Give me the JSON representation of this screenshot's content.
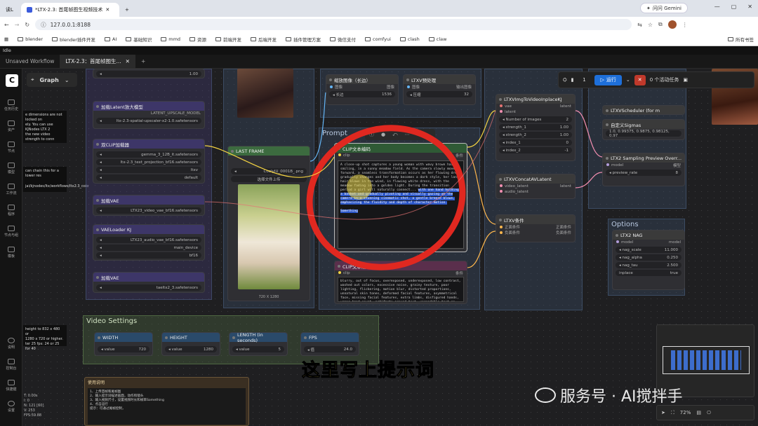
{
  "browser": {
    "tab1_label": "读L",
    "tab2_label": "*LTX-2.3: 首尾帧图生视频技术",
    "url": "127.0.0.1:8188",
    "gemini_label": "问问 Gemini",
    "bookmarks": [
      "blender",
      "blender插件开发",
      "AI",
      "基础知识",
      "mmd",
      "资源",
      "前端开发",
      "后端开发",
      "插件管理方案",
      "微信支付",
      "comfyui",
      "clash",
      "claw"
    ],
    "all_bookmarks": "所有书签"
  },
  "app": {
    "title": "Idle",
    "workflow_tabs": [
      "Unsaved Workflow",
      "LTX-2.3：首尾帧图生..."
    ],
    "view_mode": "Graph",
    "run_label": "运行",
    "queue_count": "1",
    "active_tasks": "0 个活动任务"
  },
  "sidebar": {
    "items": [
      "任务历史",
      "资产",
      "节点",
      "模型",
      "工作流",
      "程序",
      "节点与组",
      "模板",
      "说明",
      "控制台",
      "快捷键",
      "设置"
    ]
  },
  "left_panel": {
    "lines_top": [
      "e dimensions are not locked on",
      "ely. You can use KJNodes LTX 2",
      "the new video strength to conn"
    ],
    "line_mid": "can chain this for a lower res",
    "link": "jai/kjnodes/ltx/workflows/ltx2.3_colo",
    "lines_bottom": [
      "height to 832 x 480 or",
      "1280 x 720 or higher.",
      "ter 25 fps: 24 or 25 for 40"
    ],
    "stats": [
      "T: 0.00s",
      "I: 0",
      "N: 121 [60]",
      "V: 253",
      "FPS:59.88"
    ]
  },
  "nodes": {
    "strength_val": "1.00",
    "latent_upscale_title": "加载Latent放大模型",
    "latent_upscale_model": "LATENT_UPSCALE_MODEL",
    "upscale_model_file": "ltx-2.3-spatial-upscaler-x2-1.0.safetensors",
    "dual_clip_title": "双CLIP加载器",
    "clip_name1": "gemma_3_12B_it.safetensors",
    "clip_name2": "ltx-2.3_text_projection_bf16.safetensors",
    "clip_type": "ltxv",
    "clip_device": "default",
    "vae_loader1": "加载VAE",
    "vae_file1": "LTX23_video_vae_bf16.safetensors",
    "vae_kj_title": "VAELoader KJ",
    "vae_kj_file": "LTX23_audio_vae_bf16.safetensors",
    "vae_kj_device": "main_device",
    "vae_kj_dtype": "bf16",
    "vae_loader2": "加载VAE",
    "vae_file2": "taeltx2_3.safetensors",
    "last_frame_title": "LAST FRAME",
    "image_file": "CoolyIU_0001B_.png",
    "upload_label": "选择文件上传",
    "img_size": "720 X 1280",
    "clip_encode_title": "CLIP文本编码",
    "clip_encode_neg_title": "CLIP文本编码",
    "prompt_group": "Prompt",
    "prompt_text": "A close-up shot captures a young woman with wavy brown hair, smiling, in a sunny meadow field. As the camera slowly moves forward, a seamless transformation occurs as her flowing dress gradually changes and her body becomes a dark style, her long hair blows in the wind, in flowing white dress, with the meadow fading into a golden light. During the transition period a girl will naturally connect...",
    "prompt_highlight": "with one hand holding a basket and gradually pivoting and visually gazing at the camera in a stunning cinematic shot, a gentle breeze blows, emphasizing the fluidity and depth of character motion.",
    "prompt_end": "Something",
    "neg_text": "blurry, out of focus, overexposed, underexposed, low contrast, washed out colors, excessive noise, grainy texture, poor lighting, flickering, motion blur, distorted proportions, unnatural skin tones, deformed facial features, asymmetrical face, missing facial features, extra limbs, disfigured hands, wrong hand count, artifacts around text, unreadable text on shirt or hat, incorrect lettering on cap ('PNTR'), incorrect lettering on shirt ('JOY'), shaking movement...",
    "video_settings": "Video Settings",
    "width_val": "720",
    "height_val": "1280",
    "length_val": "5",
    "fps_val": "24.0",
    "width_label": "WIDTH",
    "height_label": "HEIGHT",
    "length_label": "LENGTH (in seconds)",
    "fps_label": "FPS",
    "scale_title": "缩放图像（长边）",
    "scale_val": "1536",
    "preprocess_title": "LTXV预处理",
    "preprocess_val": "32",
    "inplace_title": "LTXVImgToVideoInplaceKJ",
    "num_images": "2",
    "strength_1": "1.00",
    "strength_2": "1.00",
    "index_1": "0",
    "index_2": "-1",
    "concat_title": "LTXVConcatAVLatent",
    "cond_title": "LTXV条件",
    "scheduler_title": "LTXVScheduler (for m",
    "sigmas_title": "自定义Sigmas",
    "sigmas_val": "1.0, 0.99375, 0.9875, 0.98125, 0.97",
    "sampling_title": "LTX2 Sampling Preview Overr...",
    "preview_rate": "8",
    "nag_title": "LTX2 NAG",
    "nag_scale": "11.000",
    "nag_alpha": "0.250",
    "nag_tau": "2.500",
    "inplace": "true",
    "options_group": "Options",
    "notes_title": "使用说明",
    "notes_lines": [
      "1、上传首帧和尾帧图",
      "2、输入提示词描述画面，动作和镜头",
      "3、输入视频尺寸，设置视频时长和帧率Something",
      "4、点击运行",
      "",
      "提示：可通过尾帧控制，"
    ]
  },
  "subtitle": "这里写上提示词",
  "watermark": "服务号 · AI搅拌手",
  "zoom": "72%"
}
